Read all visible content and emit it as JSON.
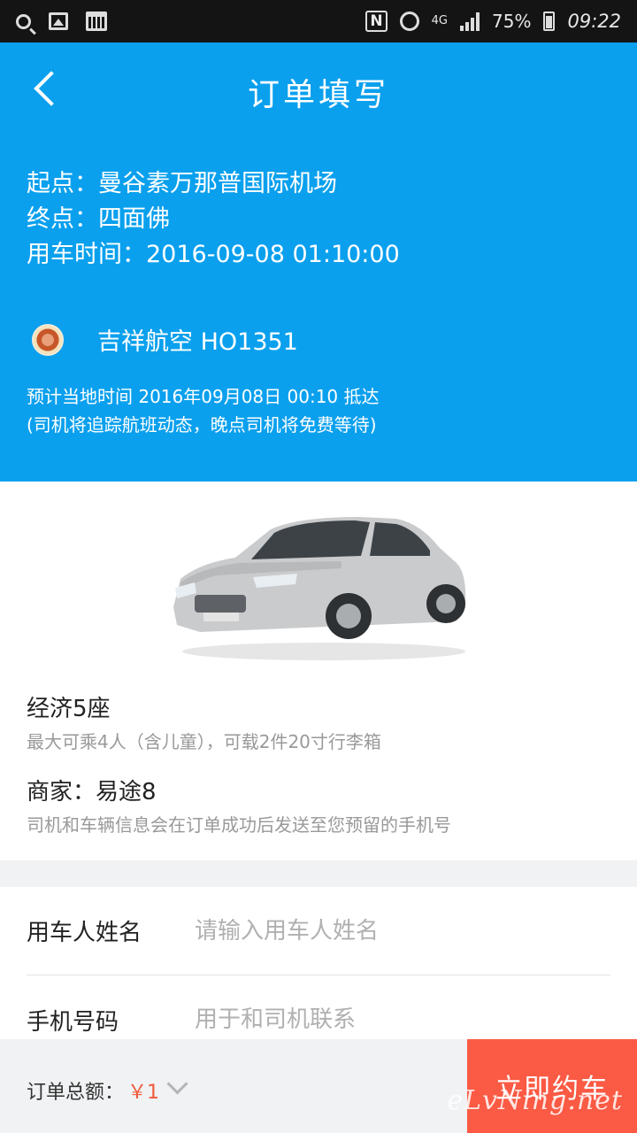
{
  "status_bar": {
    "network": "4G",
    "battery": "75%",
    "time": "09:22",
    "left_icons": [
      "search-icon",
      "image-icon",
      "calendar-icon"
    ],
    "right_icons": [
      "nfc-icon",
      "alarm-icon",
      "signal-icon",
      "battery-icon"
    ]
  },
  "header": {
    "title": "订单填写",
    "back_icon": "chevron-left-icon",
    "background_color": "#0aa0ee",
    "start_label": "起点：",
    "start_value": "曼谷素万那普国际机场",
    "end_label": "终点：",
    "end_value": "四面佛",
    "time_label": "用车时间：",
    "time_value": "2016-09-08 01:10:00"
  },
  "flight": {
    "airline": "吉祥航空",
    "flight_no": "HO1351",
    "arrival_line": "预计当地时间 2016年09月08日 00:10 抵达",
    "note": "(司机将追踪航班动态，晚点司机将免费等待)"
  },
  "car": {
    "type": "经济5座",
    "capacity": "最大可乘4人（含儿童），可载2件20寸行李箱",
    "merchant_label": "商家：",
    "merchant_value": "易途8",
    "merchant_note": "司机和车辆信息会在订单成功后发送至您预留的手机号"
  },
  "form": {
    "name_label": "用车人姓名",
    "name_placeholder": "请输入用车人姓名",
    "phone_label": "手机号码",
    "phone_placeholder": "用于和司机联系"
  },
  "footer": {
    "total_label": "订单总额：",
    "total_value": "￥1",
    "book_label": "立即约车",
    "watermark": "eLvNing.net",
    "accent_color": "#fb5a44"
  }
}
